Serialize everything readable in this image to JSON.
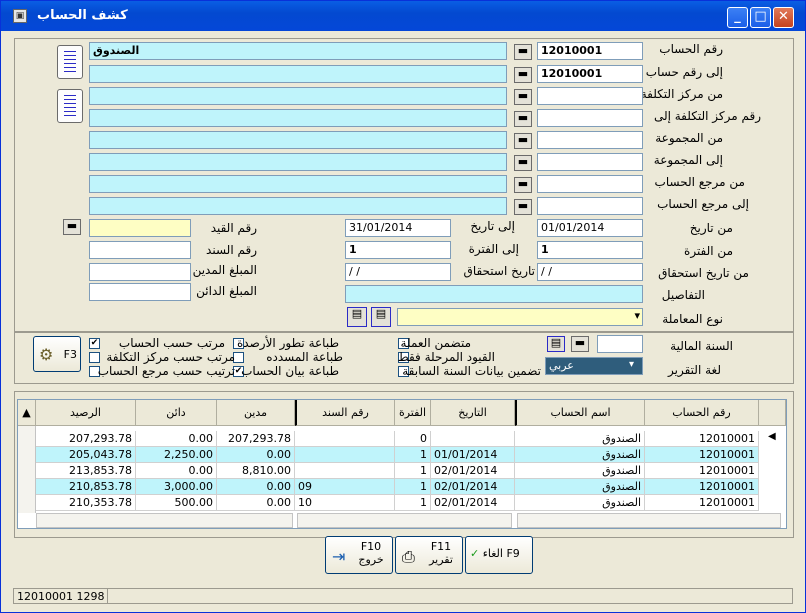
{
  "window": {
    "title": "كشف الحساب"
  },
  "fields": {
    "account_no_label": "رقم الحساب",
    "account_no": "12010001",
    "account_name": "الصندوق",
    "to_account_label": "إلى رقم حساب",
    "to_account": "12010001",
    "from_cost_center_label": "من مركز التكلفة",
    "to_cost_center_label": "رقم مركز التكلفة إلى",
    "from_group_label": "من المجموعة",
    "to_group_label": "إلى المجموعة",
    "from_ref_label": "من مرجع الحساب",
    "to_ref_label": "إلى مرجع الحساب",
    "from_date_label": "من تاريخ",
    "from_date": "01/01/2014",
    "to_date_label": "إلى تاريخ",
    "to_date": "31/01/2014",
    "entry_no_label": "رقم القيد",
    "from_period_label": "من الفترة",
    "from_period": "1",
    "to_period_label": "إلى الفترة",
    "to_period": "1",
    "voucher_no_label": "رقم السند",
    "from_due_label": "من تاريخ استحقاق",
    "from_due": "/ /",
    "to_due_label": "تاريخ استحقاق",
    "to_due": "/ /",
    "debit_amount_label": "المبلغ المدين",
    "credit_amount_label": "المبلغ الدائن",
    "details_label": "التفاصيل",
    "transaction_type_label": "نوع المعاملة"
  },
  "options": {
    "fiscal_year_label": "السنة المالية",
    "report_lang_label": "لغة التقرير",
    "report_lang_value": "عربي",
    "incl_currency": "متضمن العملة",
    "stage_only": "القيود المرحلة فقط",
    "prev_year": "تضمين بيانات السنة السابقة",
    "print_balance_dev": "طباعة تطور الأرصدة",
    "print_paid": "طباعة المسدده",
    "print_account_stmt": "طباعة بيان الحساب",
    "sort_by_account": "مرتب حسب الحساب",
    "sort_by_cost_center": "مرتب حسب مركز التكلفة",
    "sort_by_ref": "ترتيب حسب مرجع الحساب",
    "f3_label": "F3"
  },
  "grid": {
    "headers": [
      "رقم الحساب",
      "اسم الحساب",
      "التاريخ",
      "الفترة",
      "رقم السند",
      "مدين",
      "دائن",
      "الرصيد"
    ],
    "rows": [
      [
        "12010001",
        "الصندوق",
        "",
        "0",
        "",
        "207,293.78",
        "0.00",
        "207,293.78"
      ],
      [
        "12010001",
        "الصندوق",
        "01/01/2014",
        "1",
        "",
        "0.00",
        "2,250.00",
        "205,043.78"
      ],
      [
        "12010001",
        "الصندوق",
        "02/01/2014",
        "1",
        "",
        "8,810.00",
        "0.00",
        "213,853.78"
      ],
      [
        "12010001",
        "الصندوق",
        "02/01/2014",
        "1",
        "09",
        "0.00",
        "3,000.00",
        "210,853.78"
      ],
      [
        "12010001",
        "الصندوق",
        "02/01/2014",
        "1",
        "10",
        "0.00",
        "500.00",
        "210,353.78"
      ]
    ]
  },
  "buttons": {
    "cancel": "الغاء F9",
    "report_key": "F11",
    "report": "تقرير",
    "exit_key": "F10",
    "exit": "خروج"
  },
  "status": {
    "text": "12010001 1298"
  }
}
